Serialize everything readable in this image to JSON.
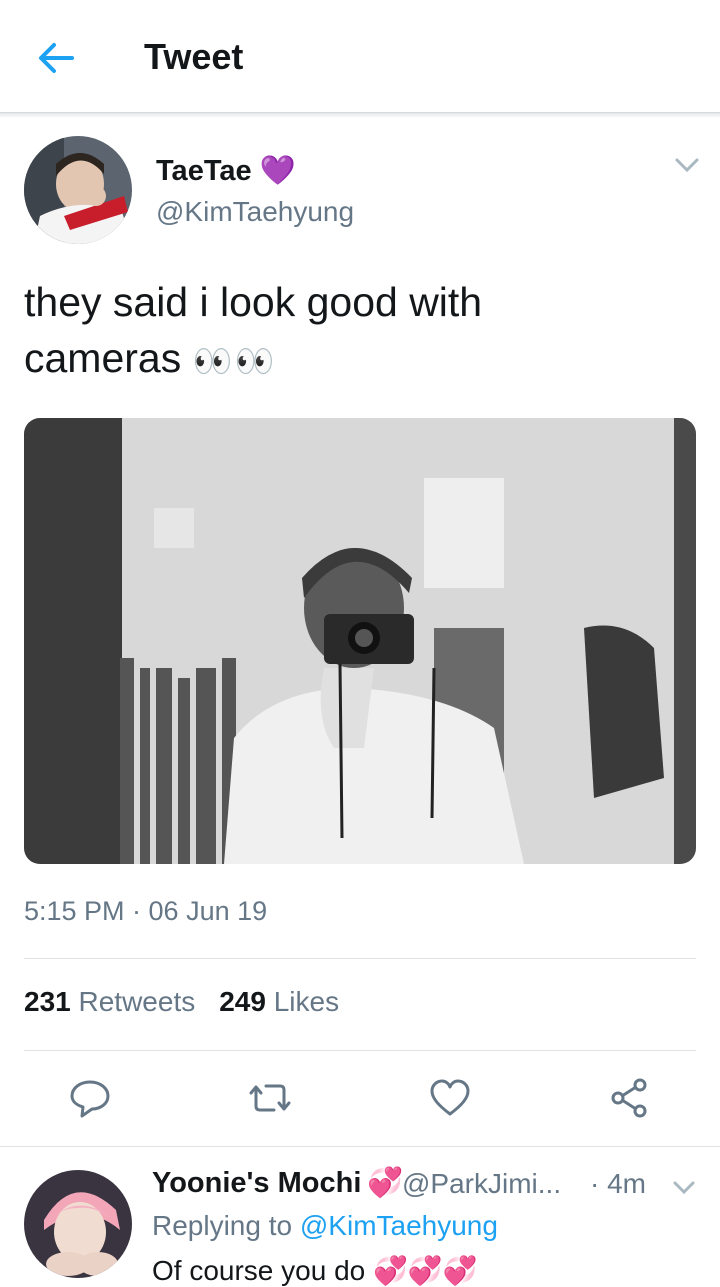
{
  "header": {
    "title": "Tweet",
    "back_icon": "arrow-left-icon"
  },
  "tweet": {
    "author_name": "TaeTae",
    "author_badge": "💜",
    "author_handle": "@KimTaehyung",
    "text": "they said i look good with cameras",
    "text_emoji": "👀👀",
    "timestamp": "5:15 PM · 06 Jun 19",
    "retweets_count": "231",
    "retweets_label": "Retweets",
    "likes_count": "249",
    "likes_label": "Likes"
  },
  "actions": [
    "reply-icon",
    "retweet-icon",
    "like-icon",
    "share-icon"
  ],
  "reply": {
    "author_name": "Yoonie's Mochi",
    "author_badge": "💞",
    "author_handle": "@ParkJimi...",
    "time": "· 4m",
    "replying_prefix": "Replying to",
    "replying_handle": "@KimTaehyung",
    "text": "Of course you do",
    "text_emoji": "💞💞💞"
  },
  "colors": {
    "accent": "#1da1f2",
    "secondary_text": "#657786",
    "primary_text": "#14171a"
  }
}
